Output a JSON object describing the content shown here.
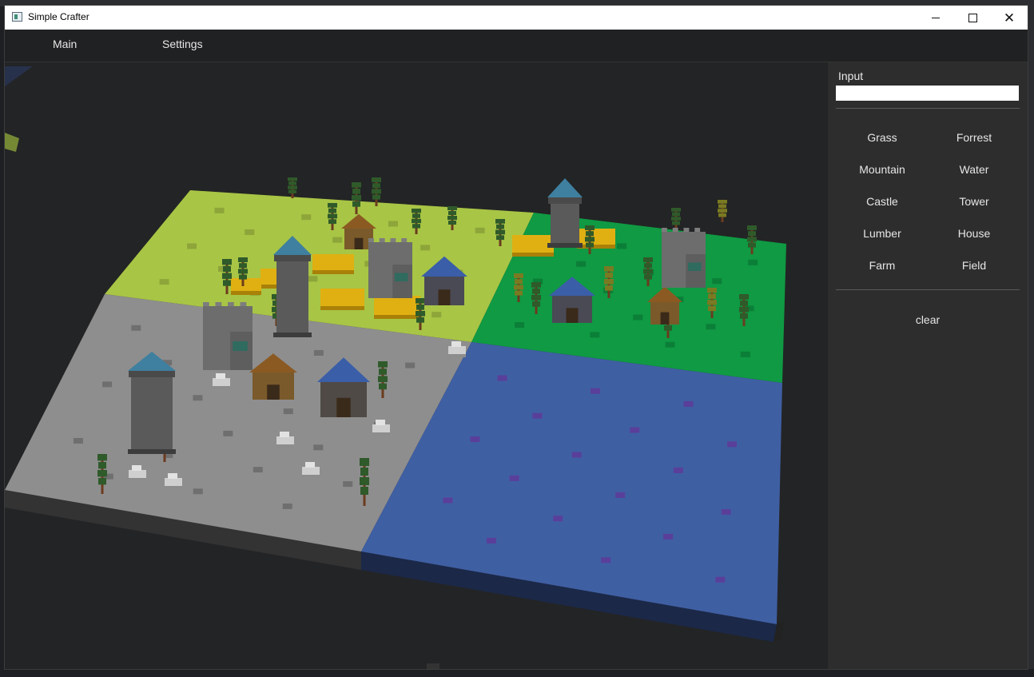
{
  "window": {
    "title": "Simple Crafter"
  },
  "menu": {
    "main": "Main",
    "settings": "Settings"
  },
  "panel": {
    "input_label": "Input",
    "input_value": "",
    "tiles": [
      "Grass",
      "Forrest",
      "Mountain",
      "Water",
      "Castle",
      "Tower",
      "Lumber",
      "House",
      "Farm",
      "Field"
    ],
    "clear_label": "clear"
  },
  "colors": {
    "grass": "#a8c545",
    "forest": "#0f9a43",
    "mountain": "#8e8e8e",
    "water": "#3f5fa3",
    "field": "#e0b012",
    "background": "#232425"
  },
  "icons": {
    "app": "app-icon",
    "minimize": "minimize-icon",
    "maximize": "maximize-icon",
    "close": "close-icon"
  }
}
